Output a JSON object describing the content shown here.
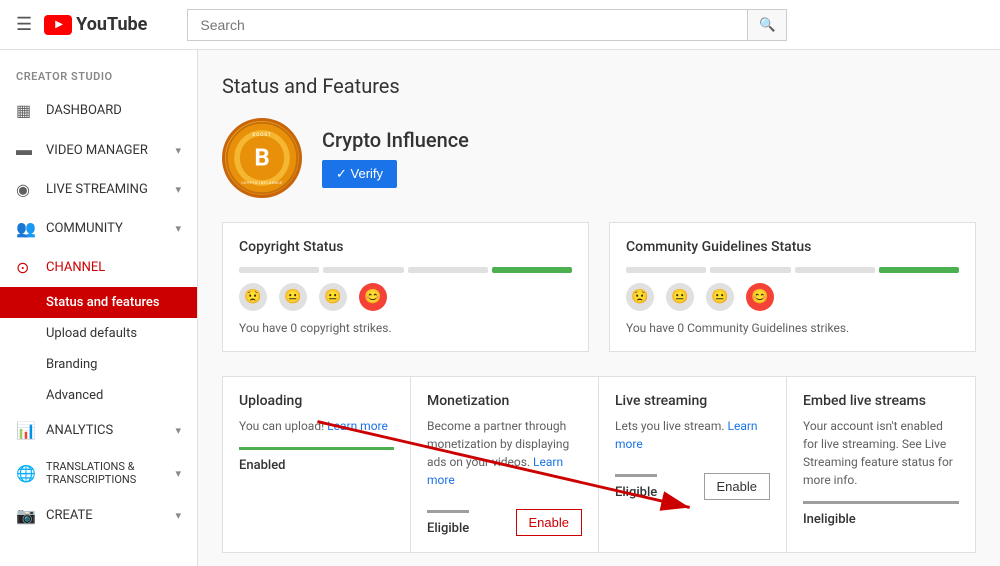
{
  "topNav": {
    "hamburger": "☰",
    "logoText": "YouTube",
    "searchPlaceholder": "Search",
    "searchIcon": "🔍"
  },
  "sidebar": {
    "creatorStudioLabel": "CREATOR STUDIO",
    "items": [
      {
        "id": "dashboard",
        "icon": "▦",
        "label": "DASHBOARD",
        "hasChevron": false
      },
      {
        "id": "video-manager",
        "icon": "▬",
        "label": "VIDEO MANAGER",
        "hasChevron": true
      },
      {
        "id": "live-streaming",
        "icon": "◉",
        "label": "LIVE STREAMING",
        "hasChevron": true
      },
      {
        "id": "community",
        "icon": "👥",
        "label": "COMMUNITY",
        "hasChevron": true
      },
      {
        "id": "channel",
        "icon": "⊙",
        "label": "CHANNEL",
        "hasChevron": false,
        "active": true
      }
    ],
    "channelSubItems": [
      {
        "id": "status-features",
        "label": "Status and features",
        "active": true
      },
      {
        "id": "upload-defaults",
        "label": "Upload defaults",
        "active": false
      },
      {
        "id": "branding",
        "label": "Branding",
        "active": false
      },
      {
        "id": "advanced",
        "label": "Advanced",
        "active": false
      }
    ],
    "bottomItems": [
      {
        "id": "analytics",
        "icon": "📊",
        "label": "ANALYTICS",
        "hasChevron": true
      },
      {
        "id": "translations",
        "icon": "🌐",
        "label": "TRANSLATIONS & TRANSCRIPTIONS",
        "hasChevron": true
      },
      {
        "id": "create",
        "icon": "📷",
        "label": "CREATE",
        "hasChevron": true
      }
    ]
  },
  "mainContent": {
    "pageTitle": "Status and Features",
    "channel": {
      "name": "Crypto Influence",
      "verifyLabel": "✓ Verify"
    },
    "copyrightStatus": {
      "title": "Copyright Status",
      "strikeText": "You have 0 copyright strikes."
    },
    "communityGuidelinesStatus": {
      "title": "Community Guidelines Status",
      "strikeText": "You have 0 Community Guidelines strikes."
    },
    "featureCards": [
      {
        "id": "uploading",
        "title": "Uploading",
        "desc": "You can upload! Learn more",
        "statusLabel": "Enabled",
        "statusType": "green",
        "hasButton": false
      },
      {
        "id": "monetization",
        "title": "Monetization",
        "desc": "Become a partner through monetization by displaying ads on your videos. Learn more",
        "statusLabel": "Eligible",
        "statusType": "grey",
        "hasButton": true,
        "buttonLabel": "Enable",
        "buttonHighlighted": true
      },
      {
        "id": "live-streaming",
        "title": "Live streaming",
        "desc": "Lets you live stream. Learn more",
        "statusLabel": "Eligible",
        "statusType": "grey",
        "hasButton": true,
        "buttonLabel": "Enable",
        "buttonHighlighted": false
      },
      {
        "id": "embed-live-streams",
        "title": "Embed live streams",
        "desc": "Your account isn't enabled for live streaming. See Live Streaming feature status for more info.",
        "statusLabel": "Ineligible",
        "statusType": "grey",
        "hasButton": false
      }
    ]
  }
}
